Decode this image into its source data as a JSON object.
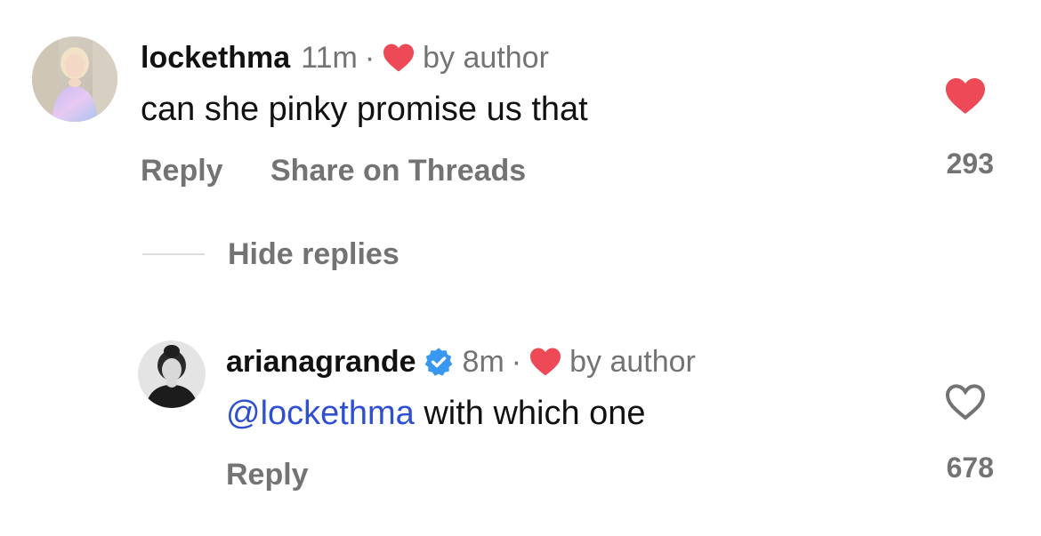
{
  "comment": {
    "username": "lockethma",
    "time": "11m",
    "separator": "·",
    "liked_by_author_label": "by author",
    "text": "can she pinky promise us that",
    "reply_label": "Reply",
    "share_label": "Share on Threads",
    "like_count": "293",
    "liked": true,
    "avatar_icon": "user-avatar"
  },
  "replies_toggle": {
    "label": "Hide replies"
  },
  "reply": {
    "username": "arianagrande",
    "verified": true,
    "time": "8m",
    "separator": "·",
    "liked_by_author_label": "by author",
    "mention": "@lockethma",
    "text": " with which one",
    "reply_label": "Reply",
    "like_count": "678",
    "liked": false,
    "avatar_icon": "user-avatar"
  },
  "colors": {
    "heart_red": "#ed4956",
    "verified_blue": "#3897f0",
    "mention_blue": "#2f4fd1",
    "meta_gray": "#737373"
  }
}
